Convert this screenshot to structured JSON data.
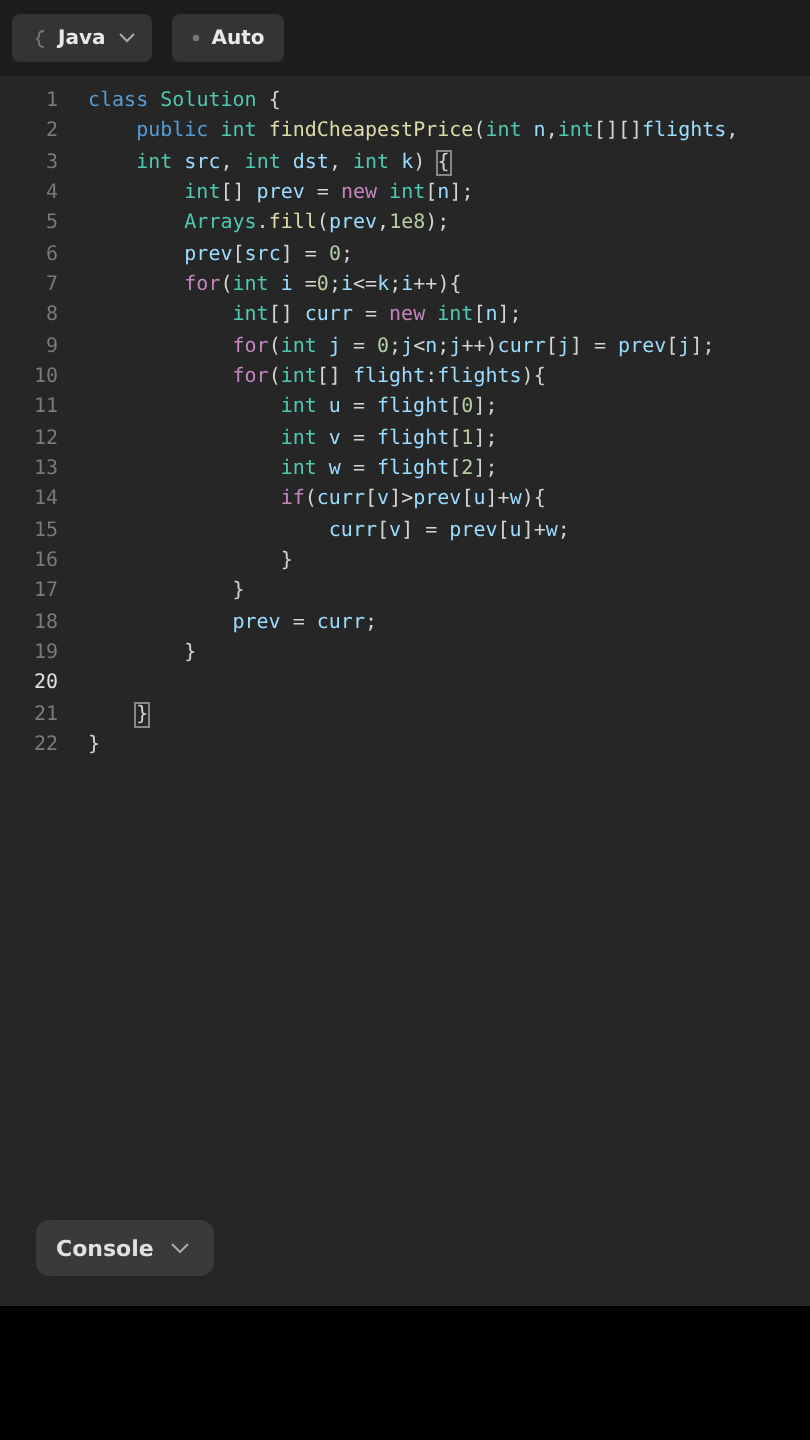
{
  "toolbar": {
    "language": {
      "label": "Java"
    },
    "mode": {
      "label": "Auto"
    }
  },
  "editor": {
    "lines": [
      {
        "number": "1",
        "active": false,
        "tokens": [
          {
            "kind": "keyword",
            "text": "class"
          },
          {
            "kind": "class",
            "text": " Solution"
          },
          {
            "kind": "plain",
            "text": " {"
          }
        ]
      },
      {
        "number": "2",
        "active": false,
        "tokens": [
          {
            "kind": "keyword",
            "text": "    public"
          },
          {
            "kind": "type",
            "text": " int"
          },
          {
            "kind": "function",
            "text": " findCheapestPrice"
          },
          {
            "kind": "plain",
            "text": "("
          },
          {
            "kind": "type",
            "text": "int"
          },
          {
            "kind": "variable",
            "text": " n"
          },
          {
            "kind": "plain",
            "text": ","
          },
          {
            "kind": "type",
            "text": "int"
          },
          {
            "kind": "plain",
            "text": "[][]"
          },
          {
            "kind": "variable",
            "text": "flights"
          },
          {
            "kind": "plain",
            "text": ","
          }
        ]
      },
      {
        "number": "3",
        "active": false,
        "tokens": [
          {
            "kind": "type",
            "text": "    int"
          },
          {
            "kind": "variable",
            "text": " src"
          },
          {
            "kind": "plain",
            "text": ","
          },
          {
            "kind": "type",
            "text": " int"
          },
          {
            "kind": "variable",
            "text": " dst"
          },
          {
            "kind": "plain",
            "text": ","
          },
          {
            "kind": "type",
            "text": " int"
          },
          {
            "kind": "variable",
            "text": " k"
          },
          {
            "kind": "plain",
            "text": ") "
          },
          {
            "kind": "bracket-match",
            "text": "{"
          }
        ]
      },
      {
        "number": "4",
        "active": false,
        "tokens": [
          {
            "kind": "type",
            "text": "        int"
          },
          {
            "kind": "plain",
            "text": "[]"
          },
          {
            "kind": "variable",
            "text": " prev"
          },
          {
            "kind": "plain",
            "text": " ="
          },
          {
            "kind": "control",
            "text": " new"
          },
          {
            "kind": "type",
            "text": " int"
          },
          {
            "kind": "plain",
            "text": "["
          },
          {
            "kind": "variable",
            "text": "n"
          },
          {
            "kind": "plain",
            "text": "];"
          }
        ]
      },
      {
        "number": "5",
        "active": false,
        "tokens": [
          {
            "kind": "class",
            "text": "        Arrays"
          },
          {
            "kind": "plain",
            "text": "."
          },
          {
            "kind": "function",
            "text": "fill"
          },
          {
            "kind": "plain",
            "text": "("
          },
          {
            "kind": "variable",
            "text": "prev"
          },
          {
            "kind": "plain",
            "text": ","
          },
          {
            "kind": "number",
            "text": "1e8"
          },
          {
            "kind": "plain",
            "text": ");"
          }
        ]
      },
      {
        "number": "6",
        "active": false,
        "tokens": [
          {
            "kind": "variable",
            "text": "        prev"
          },
          {
            "kind": "plain",
            "text": "["
          },
          {
            "kind": "variable",
            "text": "src"
          },
          {
            "kind": "plain",
            "text": "] = "
          },
          {
            "kind": "number",
            "text": "0"
          },
          {
            "kind": "plain",
            "text": ";"
          }
        ]
      },
      {
        "number": "7",
        "active": false,
        "tokens": [
          {
            "kind": "control",
            "text": "        for"
          },
          {
            "kind": "plain",
            "text": "("
          },
          {
            "kind": "type",
            "text": "int"
          },
          {
            "kind": "variable",
            "text": " i"
          },
          {
            "kind": "plain",
            "text": " ="
          },
          {
            "kind": "number",
            "text": "0"
          },
          {
            "kind": "plain",
            "text": ";"
          },
          {
            "kind": "variable",
            "text": "i"
          },
          {
            "kind": "plain",
            "text": "<="
          },
          {
            "kind": "variable",
            "text": "k"
          },
          {
            "kind": "plain",
            "text": ";"
          },
          {
            "kind": "variable",
            "text": "i"
          },
          {
            "kind": "plain",
            "text": "++){"
          }
        ]
      },
      {
        "number": "8",
        "active": false,
        "tokens": [
          {
            "kind": "type",
            "text": "            int"
          },
          {
            "kind": "plain",
            "text": "[]"
          },
          {
            "kind": "variable",
            "text": " curr"
          },
          {
            "kind": "plain",
            "text": " ="
          },
          {
            "kind": "control",
            "text": " new"
          },
          {
            "kind": "type",
            "text": " int"
          },
          {
            "kind": "plain",
            "text": "["
          },
          {
            "kind": "variable",
            "text": "n"
          },
          {
            "kind": "plain",
            "text": "];"
          }
        ]
      },
      {
        "number": "9",
        "active": false,
        "tokens": [
          {
            "kind": "control",
            "text": "            for"
          },
          {
            "kind": "plain",
            "text": "("
          },
          {
            "kind": "type",
            "text": "int"
          },
          {
            "kind": "variable",
            "text": " j"
          },
          {
            "kind": "plain",
            "text": " = "
          },
          {
            "kind": "number",
            "text": "0"
          },
          {
            "kind": "plain",
            "text": ";"
          },
          {
            "kind": "variable",
            "text": "j"
          },
          {
            "kind": "plain",
            "text": "<"
          },
          {
            "kind": "variable",
            "text": "n"
          },
          {
            "kind": "plain",
            "text": ";"
          },
          {
            "kind": "variable",
            "text": "j"
          },
          {
            "kind": "plain",
            "text": "++)"
          },
          {
            "kind": "variable",
            "text": "curr"
          },
          {
            "kind": "plain",
            "text": "["
          },
          {
            "kind": "variable",
            "text": "j"
          },
          {
            "kind": "plain",
            "text": "] = "
          },
          {
            "kind": "variable",
            "text": "prev"
          },
          {
            "kind": "plain",
            "text": "["
          },
          {
            "kind": "variable",
            "text": "j"
          },
          {
            "kind": "plain",
            "text": "];"
          }
        ]
      },
      {
        "number": "10",
        "active": false,
        "tokens": [
          {
            "kind": "control",
            "text": "            for"
          },
          {
            "kind": "plain",
            "text": "("
          },
          {
            "kind": "type",
            "text": "int"
          },
          {
            "kind": "plain",
            "text": "[]"
          },
          {
            "kind": "variable",
            "text": " flight"
          },
          {
            "kind": "plain",
            "text": ":"
          },
          {
            "kind": "variable",
            "text": "flights"
          },
          {
            "kind": "plain",
            "text": "){"
          }
        ]
      },
      {
        "number": "11",
        "active": false,
        "tokens": [
          {
            "kind": "type",
            "text": "                int"
          },
          {
            "kind": "variable",
            "text": " u"
          },
          {
            "kind": "plain",
            "text": " = "
          },
          {
            "kind": "variable",
            "text": "flight"
          },
          {
            "kind": "plain",
            "text": "["
          },
          {
            "kind": "number",
            "text": "0"
          },
          {
            "kind": "plain",
            "text": "];"
          }
        ]
      },
      {
        "number": "12",
        "active": false,
        "tokens": [
          {
            "kind": "type",
            "text": "                int"
          },
          {
            "kind": "variable",
            "text": " v"
          },
          {
            "kind": "plain",
            "text": " = "
          },
          {
            "kind": "variable",
            "text": "flight"
          },
          {
            "kind": "plain",
            "text": "["
          },
          {
            "kind": "number",
            "text": "1"
          },
          {
            "kind": "plain",
            "text": "];"
          }
        ]
      },
      {
        "number": "13",
        "active": false,
        "tokens": [
          {
            "kind": "type",
            "text": "                int"
          },
          {
            "kind": "variable",
            "text": " w"
          },
          {
            "kind": "plain",
            "text": " = "
          },
          {
            "kind": "variable",
            "text": "flight"
          },
          {
            "kind": "plain",
            "text": "["
          },
          {
            "kind": "number",
            "text": "2"
          },
          {
            "kind": "plain",
            "text": "];"
          }
        ]
      },
      {
        "number": "14",
        "active": false,
        "tokens": [
          {
            "kind": "control",
            "text": "                if"
          },
          {
            "kind": "plain",
            "text": "("
          },
          {
            "kind": "variable",
            "text": "curr"
          },
          {
            "kind": "plain",
            "text": "["
          },
          {
            "kind": "variable",
            "text": "v"
          },
          {
            "kind": "plain",
            "text": "]>"
          },
          {
            "kind": "variable",
            "text": "prev"
          },
          {
            "kind": "plain",
            "text": "["
          },
          {
            "kind": "variable",
            "text": "u"
          },
          {
            "kind": "plain",
            "text": "]+"
          },
          {
            "kind": "variable",
            "text": "w"
          },
          {
            "kind": "plain",
            "text": "){"
          }
        ]
      },
      {
        "number": "15",
        "active": false,
        "tokens": [
          {
            "kind": "variable",
            "text": "                    curr"
          },
          {
            "kind": "plain",
            "text": "["
          },
          {
            "kind": "variable",
            "text": "v"
          },
          {
            "kind": "plain",
            "text": "] = "
          },
          {
            "kind": "variable",
            "text": "prev"
          },
          {
            "kind": "plain",
            "text": "["
          },
          {
            "kind": "variable",
            "text": "u"
          },
          {
            "kind": "plain",
            "text": "]+"
          },
          {
            "kind": "variable",
            "text": "w"
          },
          {
            "kind": "plain",
            "text": ";"
          }
        ]
      },
      {
        "number": "16",
        "active": false,
        "tokens": [
          {
            "kind": "plain",
            "text": "                }"
          }
        ]
      },
      {
        "number": "17",
        "active": false,
        "tokens": [
          {
            "kind": "plain",
            "text": "            }"
          }
        ]
      },
      {
        "number": "18",
        "active": false,
        "tokens": [
          {
            "kind": "variable",
            "text": "            prev"
          },
          {
            "kind": "plain",
            "text": " ="
          },
          {
            "kind": "variable",
            "text": " curr"
          },
          {
            "kind": "plain",
            "text": ";"
          }
        ]
      },
      {
        "number": "19",
        "active": false,
        "tokens": [
          {
            "kind": "plain",
            "text": "        }"
          }
        ]
      },
      {
        "number": "20",
        "active": true
      },
      {
        "number": "21",
        "active": false,
        "tokens": [
          {
            "kind": "bracket-match",
            "text": "    }"
          }
        ]
      },
      {
        "number": "22",
        "active": false,
        "tokens": [
          {
            "kind": "plain",
            "text": "}"
          }
        ]
      }
    ]
  },
  "console": {
    "label": "Console"
  }
}
